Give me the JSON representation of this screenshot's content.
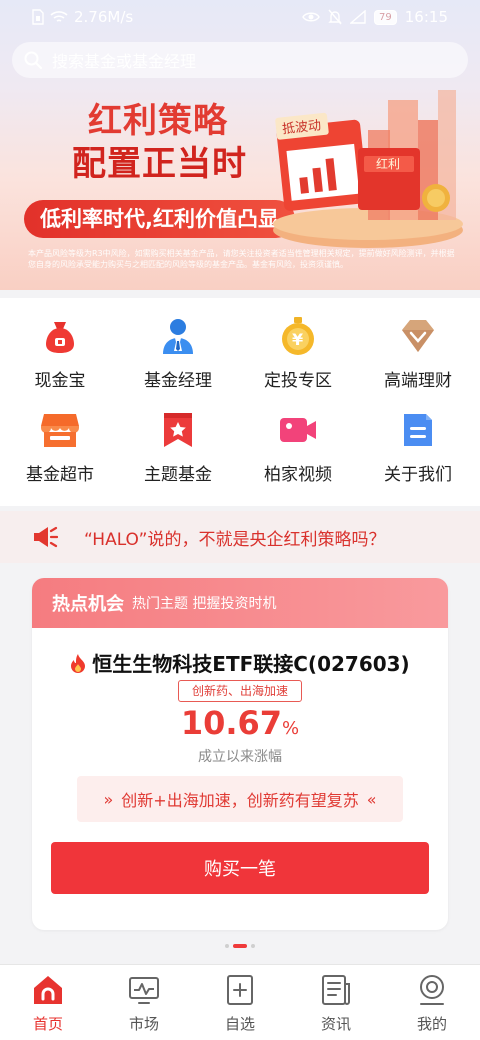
{
  "status_bar": {
    "net_speed": "2.76M/s",
    "battery": "79",
    "time": "16:15"
  },
  "search": {
    "placeholder": "搜索基金或基金经理"
  },
  "banner": {
    "title_line1": "红利策略",
    "title_line2": "配置正当时",
    "pill_text": "低利率时代,红利价值凸显",
    "disclaimer": "本产品风险等级为R3中风险，如需购买相关基金产品，请您关注投资者适当性管理相关规定，提前做好风险测评，并根据您自身的风险承受能力购买与之相匹配的风险等级的基金产品。基金有风险，投资须谨慎。",
    "sign_left": "抵波动",
    "sign_right": "红利"
  },
  "quick_menu": [
    {
      "label": "现金宝",
      "icon": "money-bag-icon"
    },
    {
      "label": "基金经理",
      "icon": "manager-icon"
    },
    {
      "label": "定投专区",
      "icon": "yen-medal-icon"
    },
    {
      "label": "高端理财",
      "icon": "diamond-icon"
    },
    {
      "label": "基金超市",
      "icon": "store-icon"
    },
    {
      "label": "主题基金",
      "icon": "bookmark-star-icon"
    },
    {
      "label": "柏家视频",
      "icon": "video-camera-icon"
    },
    {
      "label": "关于我们",
      "icon": "document-icon"
    }
  ],
  "notice": {
    "text": "“HALO”说的，不就是央企红利策略吗？"
  },
  "hot_card": {
    "title": "热点机会",
    "subtitle": "热门主题 把握投资时机",
    "fund_name": "恒生生物科技ETF联接C(027603)",
    "tag": "创新药、出海加速",
    "return_value": "10.67",
    "return_unit": "%",
    "return_label": "成立以来涨幅",
    "slogan_left": "»",
    "slogan": "创新+出海加速，创新药有望复苏",
    "slogan_right": "«",
    "buy_label": "购买一笔"
  },
  "pager": {
    "count": 3,
    "active": 1
  },
  "tab_bar": [
    {
      "label": "首页",
      "icon": "home-icon",
      "active": true
    },
    {
      "label": "市场",
      "icon": "market-icon",
      "active": false
    },
    {
      "label": "自选",
      "icon": "watchlist-icon",
      "active": false
    },
    {
      "label": "资讯",
      "icon": "news-icon",
      "active": false
    },
    {
      "label": "我的",
      "icon": "profile-icon",
      "active": false
    }
  ],
  "colors": {
    "brand_red": "#e7332f",
    "notice_bg": "#f7eeee",
    "hot_header": "#f57c80"
  }
}
